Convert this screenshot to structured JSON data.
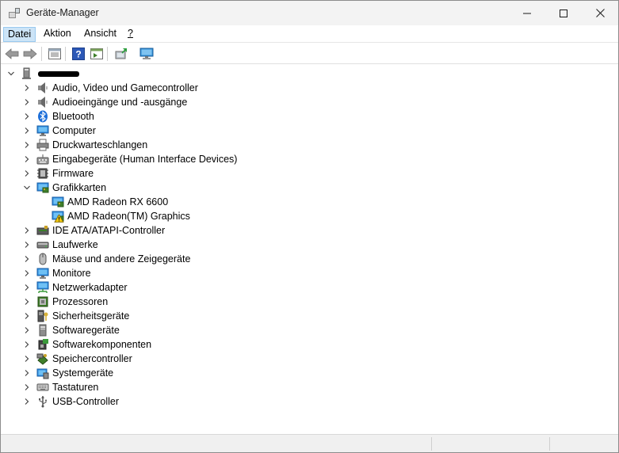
{
  "window": {
    "title": "Geräte-Manager"
  },
  "menu": {
    "datei": "Datei",
    "aktion": "Aktion",
    "ansicht": "Ansicht",
    "help": "?"
  },
  "toolbar": [
    "back-icon",
    "forward-icon",
    "properties-view-icon",
    "help-icon",
    "details-pane-icon",
    "update-driver-icon",
    "monitor-scan-icon"
  ],
  "tree": {
    "root": {
      "label": "",
      "icon": "computer-icon"
    },
    "categories": [
      {
        "label": "Audio, Video und Gamecontroller",
        "icon": "speaker-icon"
      },
      {
        "label": "Audioeingänge und -ausgänge",
        "icon": "speaker-icon"
      },
      {
        "label": "Bluetooth",
        "icon": "bluetooth-icon"
      },
      {
        "label": "Computer",
        "icon": "monitor-icon"
      },
      {
        "label": "Druckwarteschlangen",
        "icon": "printer-icon"
      },
      {
        "label": "Eingabegeräte (Human Interface Devices)",
        "icon": "hid-icon"
      },
      {
        "label": "Firmware",
        "icon": "firmware-icon"
      },
      {
        "label": "Grafikkarten",
        "icon": "display-adapter-icon",
        "expanded": true,
        "children": [
          {
            "label": "AMD Radeon RX 6600",
            "icon": "display-adapter-icon",
            "warning": false
          },
          {
            "label": "AMD Radeon(TM) Graphics",
            "icon": "display-adapter-icon",
            "warning": true
          }
        ]
      },
      {
        "label": "IDE ATA/ATAPI-Controller",
        "icon": "ide-icon"
      },
      {
        "label": "Laufwerke",
        "icon": "disk-icon"
      },
      {
        "label": "Mäuse und andere Zeigegeräte",
        "icon": "mouse-icon"
      },
      {
        "label": "Monitore",
        "icon": "monitor-icon"
      },
      {
        "label": "Netzwerkadapter",
        "icon": "network-icon"
      },
      {
        "label": "Prozessoren",
        "icon": "cpu-icon"
      },
      {
        "label": "Sicherheitsgeräte",
        "icon": "security-icon"
      },
      {
        "label": "Softwaregeräte",
        "icon": "software-device-icon"
      },
      {
        "label": "Softwarekomponenten",
        "icon": "software-component-icon"
      },
      {
        "label": "Speichercontroller",
        "icon": "storage-controller-icon"
      },
      {
        "label": "Systemgeräte",
        "icon": "system-icon"
      },
      {
        "label": "Tastaturen",
        "icon": "keyboard-icon"
      },
      {
        "label": "USB-Controller",
        "icon": "usb-icon"
      }
    ]
  },
  "colors": {
    "accent": "#0078d4",
    "menu_active": "#cce4f7",
    "warning": "#f2c811"
  }
}
